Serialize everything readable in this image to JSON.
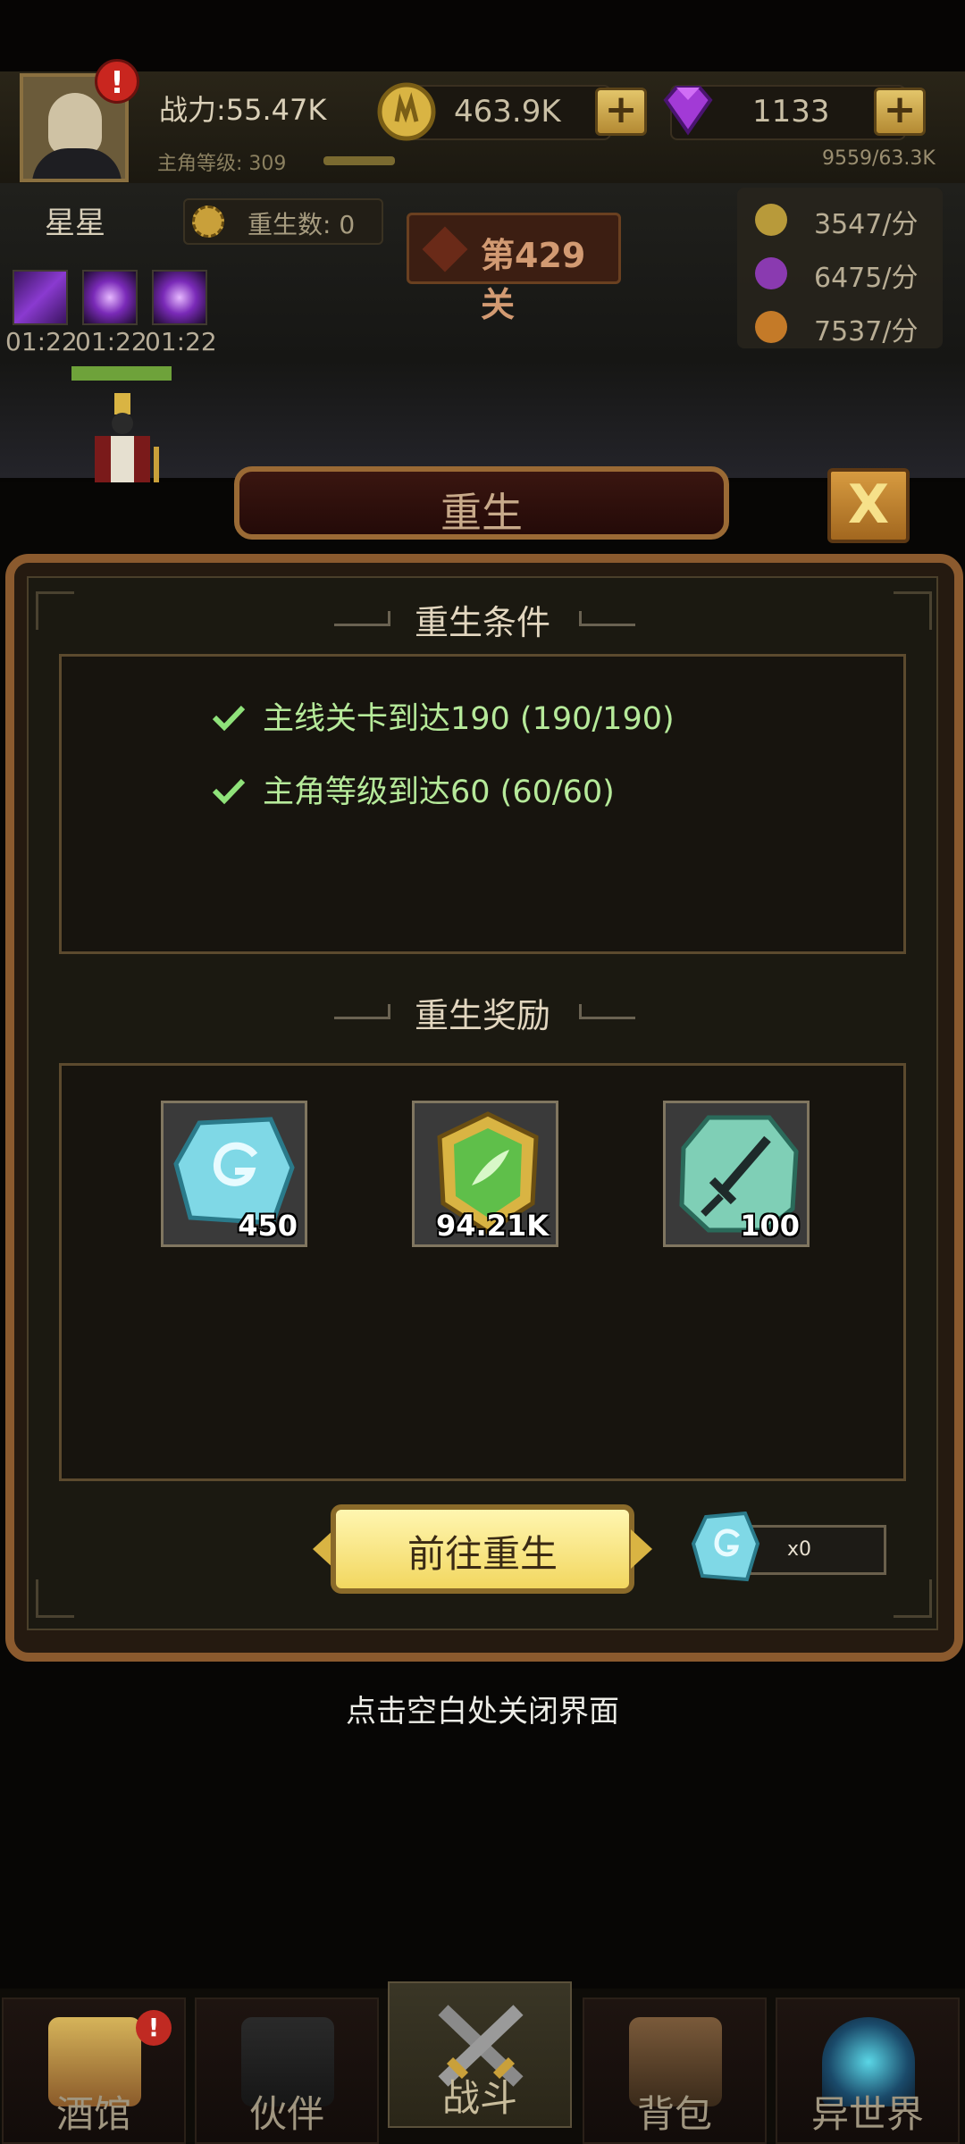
{
  "hud": {
    "power": "战力:55.47K",
    "level_label": "主角等级: 309",
    "exp": "9559/63.3K",
    "gold": "463.9K",
    "gems": "1133",
    "alert": "!"
  },
  "stage": {
    "player_name": "星星",
    "rebirth_count": "重生数: 0",
    "level": "第429关",
    "rates": [
      "3547/分",
      "6475/分",
      "7537/分"
    ],
    "buff_timers": [
      "01:22",
      "01:22",
      "01:22"
    ]
  },
  "dialog": {
    "title": "重生",
    "close_label": "X",
    "conditions_title": "重生条件",
    "conditions": [
      "主线关卡到达190 (190/190)",
      "主角等级到达60 (60/60)"
    ],
    "rewards_title": "重生奖励",
    "rewards": [
      {
        "icon": "rune-stone-icon",
        "amount": "450"
      },
      {
        "icon": "leaf-emblem-icon",
        "amount": "94.21K"
      },
      {
        "icon": "sword-tablet-icon",
        "amount": "100"
      }
    ],
    "go_button": "前往重生",
    "cost": "x0",
    "hint": "点击空白处关闭界面"
  },
  "nav": {
    "items": [
      "酒馆",
      "伙伴",
      "战斗",
      "背包",
      "异世界"
    ],
    "active": "战斗",
    "alert": "!"
  },
  "colors": {
    "condition_text": "#b6ea9a",
    "panel_border": "#8b5a2e",
    "go_button": "#f2d760"
  }
}
